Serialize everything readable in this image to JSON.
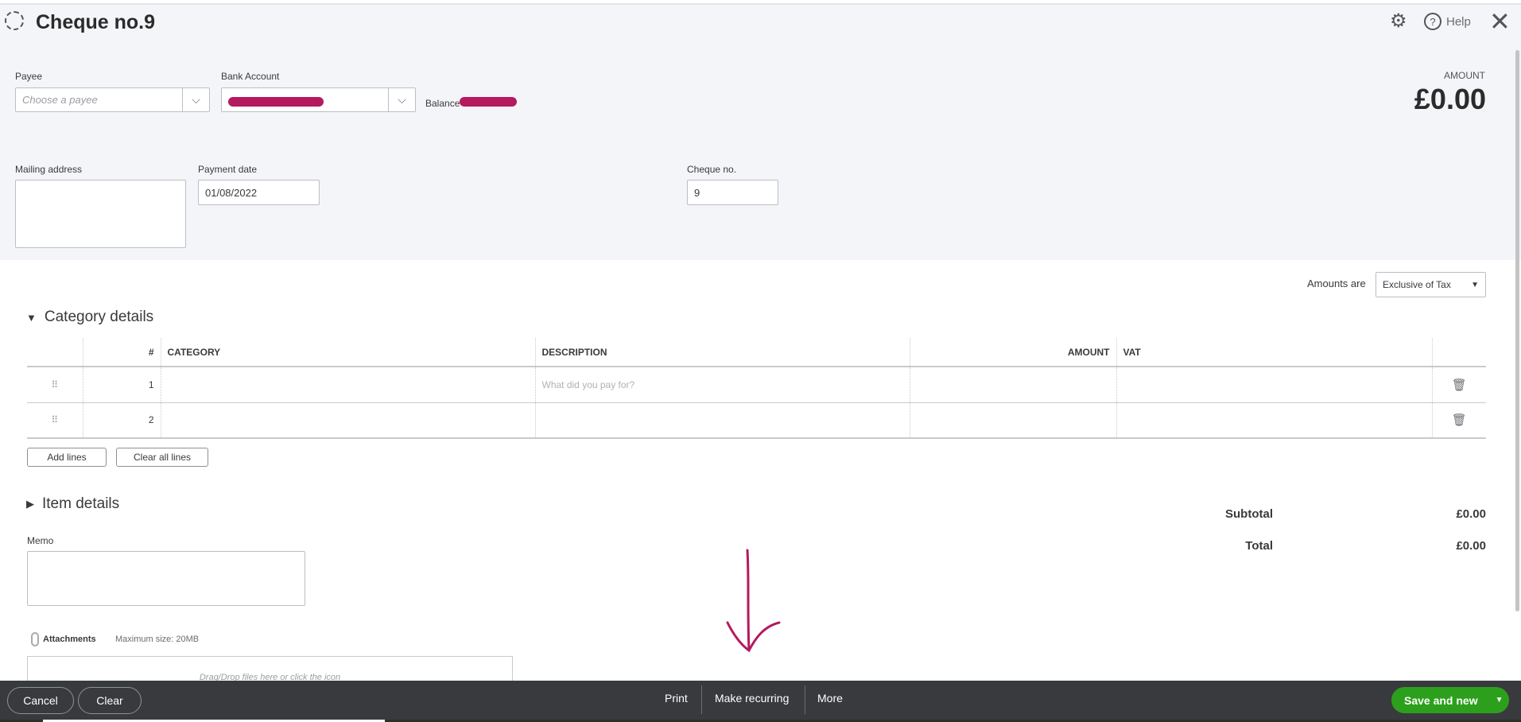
{
  "header": {
    "title": "Cheque no.9",
    "help_label": "Help"
  },
  "form": {
    "payee_label": "Payee",
    "payee_placeholder": "Choose a payee",
    "bank_account_label": "Bank Account",
    "balance_label": "Balance",
    "amount_label": "AMOUNT",
    "amount_value": "£0.00",
    "mailing_address_label": "Mailing address",
    "payment_date_label": "Payment date",
    "payment_date_value": "01/08/2022",
    "cheque_no_label": "Cheque no.",
    "cheque_no_value": "9"
  },
  "amounts_are": {
    "label": "Amounts are",
    "value": "Exclusive of Tax"
  },
  "category": {
    "title": "Category details",
    "columns": [
      "#",
      "CATEGORY",
      "DESCRIPTION",
      "AMOUNT",
      "VAT"
    ],
    "rows": [
      {
        "num": "1",
        "description_placeholder": "What did you pay for?"
      },
      {
        "num": "2"
      }
    ],
    "add_lines": "Add lines",
    "clear_all_lines": "Clear all lines"
  },
  "item_details": {
    "title": "Item details"
  },
  "totals": {
    "subtotal_label": "Subtotal",
    "subtotal_value": "£0.00",
    "total_label": "Total",
    "total_value": "£0.00"
  },
  "memo": {
    "label": "Memo"
  },
  "attachments": {
    "label": "Attachments",
    "max_size": "Maximum size: 20MB",
    "drop_text": "Drag/Drop files here or click the icon"
  },
  "footer": {
    "cancel": "Cancel",
    "clear": "Clear",
    "print": "Print",
    "make_recurring": "Make recurring",
    "more": "More",
    "save_and_new": "Save and new"
  },
  "colors": {
    "accent_green": "#2ca01c",
    "footer_bg": "#393a3d",
    "annotation": "#b5195f"
  }
}
